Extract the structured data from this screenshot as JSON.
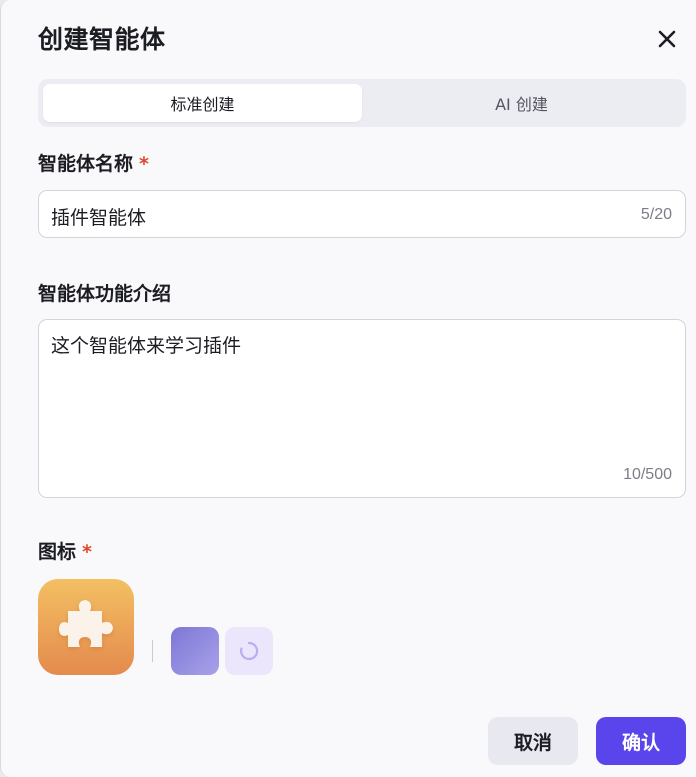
{
  "dialog": {
    "title": "创建智能体"
  },
  "tabs": [
    {
      "label": "标准创建",
      "active": true
    },
    {
      "label": "AI 创建",
      "active": false
    }
  ],
  "name_field": {
    "label": "智能体名称",
    "required_mark": "*",
    "value": "插件智能体",
    "counter": "5/20"
  },
  "description_field": {
    "label": "智能体功能介绍",
    "value": "这个智能体来学习插件",
    "counter": "10/500"
  },
  "icon_field": {
    "label": "图标",
    "required_mark": "*",
    "selected_icon": "puzzle-piece-icon",
    "selected_gradient": [
      "#f3c062",
      "#e48a4e"
    ],
    "options": [
      {
        "name": "purple-gradient-swatch",
        "colors": [
          "#7d77d6",
          "#a8a2ea"
        ]
      },
      {
        "name": "generate-icon-button",
        "icon": "loading-spinner-icon"
      }
    ]
  },
  "actions": {
    "cancel_label": "取消",
    "confirm_label": "确认"
  },
  "colors": {
    "accent": "#5a45ec",
    "required": "#e0452b"
  }
}
